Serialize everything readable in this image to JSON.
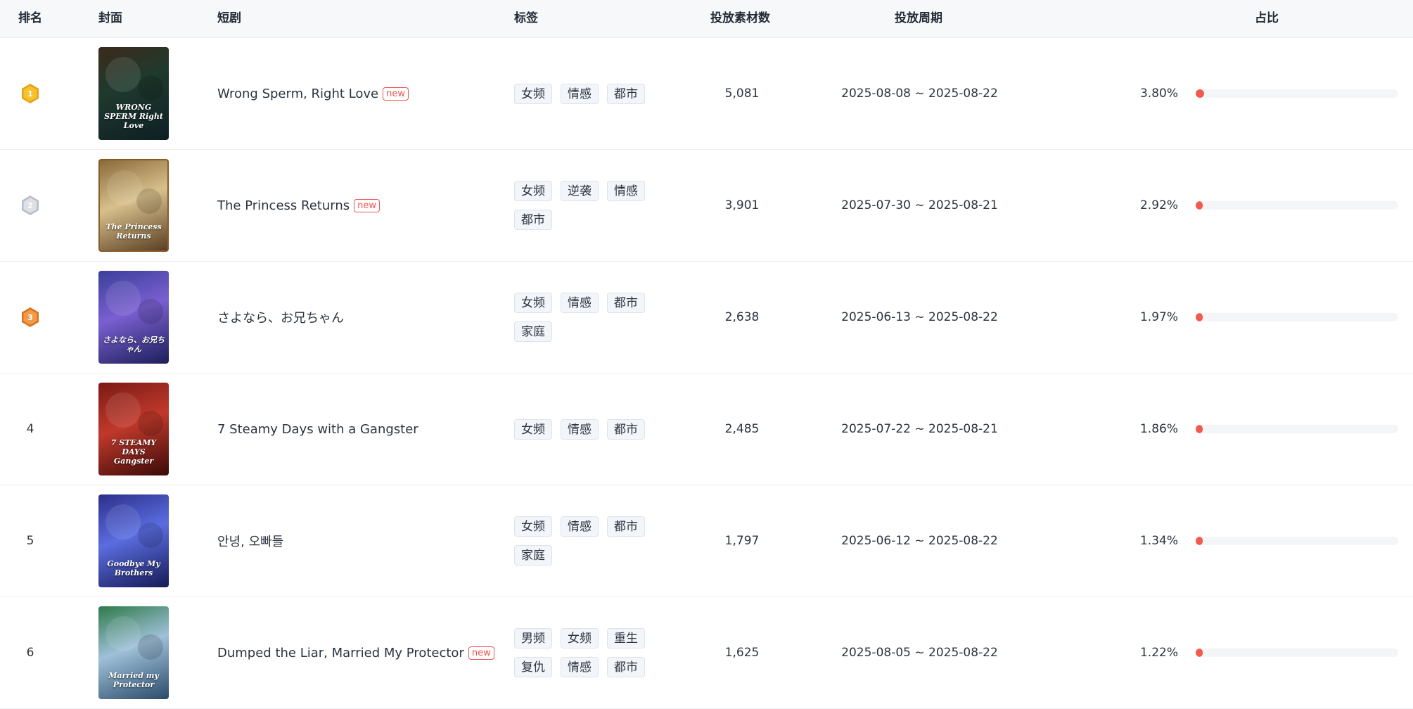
{
  "columns": {
    "rank": "排名",
    "cover": "封面",
    "drama": "短剧",
    "tags": "标签",
    "count": "投放素材数",
    "period": "投放周期",
    "share": "占比"
  },
  "colors": {
    "accent_red": "#f25b4b",
    "gold": "#f2b824",
    "silver": "#cfd3d8",
    "bronze": "#ee8a34"
  },
  "rows": [
    {
      "rank": "1",
      "medal": "gold-medal-icon",
      "cover_text": "WRONG SPERM Right Love",
      "title": "Wrong Sperm, Right Love",
      "is_new": true,
      "new_label": "new",
      "tags": [
        "女频",
        "情感",
        "都市"
      ],
      "count": "5,081",
      "period": "2025-08-08 ~ 2025-08-22",
      "share_text": "3.80%",
      "share": 3.8
    },
    {
      "rank": "2",
      "medal": "silver-medal-icon",
      "cover_text": "The Princess Returns",
      "title": "The Princess Returns",
      "is_new": true,
      "new_label": "new",
      "tags": [
        "女频",
        "逆袭",
        "情感",
        "都市"
      ],
      "count": "3,901",
      "period": "2025-07-30 ~ 2025-08-21",
      "share_text": "2.92%",
      "share": 2.92
    },
    {
      "rank": "3",
      "medal": "bronze-medal-icon",
      "cover_text": "さよなら、お兄ちゃん",
      "title": "さよなら、お兄ちゃん",
      "is_new": false,
      "new_label": "",
      "tags": [
        "女频",
        "情感",
        "都市",
        "家庭"
      ],
      "count": "2,638",
      "period": "2025-06-13 ~ 2025-08-22",
      "share_text": "1.97%",
      "share": 1.97
    },
    {
      "rank": "4",
      "medal": "",
      "cover_text": "7 STEAMY DAYS Gangster",
      "title": "7 Steamy Days with a Gangster",
      "is_new": false,
      "new_label": "",
      "tags": [
        "女频",
        "情感",
        "都市"
      ],
      "count": "2,485",
      "period": "2025-07-22 ~ 2025-08-21",
      "share_text": "1.86%",
      "share": 1.86
    },
    {
      "rank": "5",
      "medal": "",
      "cover_text": "Goodbye My Brothers",
      "title": "안녕, 오빠들",
      "is_new": false,
      "new_label": "",
      "tags": [
        "女频",
        "情感",
        "都市",
        "家庭"
      ],
      "count": "1,797",
      "period": "2025-06-12 ~ 2025-08-22",
      "share_text": "1.34%",
      "share": 1.34
    },
    {
      "rank": "6",
      "medal": "",
      "cover_text": "Married my Protector",
      "title": "Dumped the Liar, Married My Protector",
      "is_new": true,
      "new_label": "new",
      "tags": [
        "男频",
        "女频",
        "重生",
        "复仇",
        "情感",
        "都市"
      ],
      "count": "1,625",
      "period": "2025-08-05 ~ 2025-08-22",
      "share_text": "1.22%",
      "share": 1.22
    }
  ]
}
